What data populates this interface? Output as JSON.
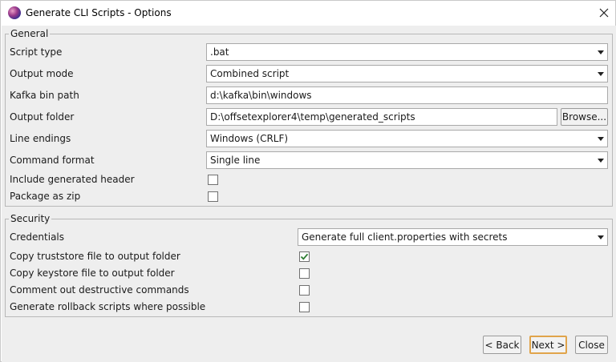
{
  "window": {
    "title": "Generate CLI Scripts - Options"
  },
  "icons": {
    "app": "app-logo-icon",
    "close": "close-icon",
    "dropdown": "chevron-down-icon",
    "check": "checkmark-icon"
  },
  "colors": {
    "dialog_bg": "#eeeeee",
    "default_button_border": "#e0a44b",
    "checkmark": "#2e7d32"
  },
  "general": {
    "title": "General",
    "script_type_label": "Script type",
    "script_type_value": ".bat",
    "output_mode_label": "Output mode",
    "output_mode_value": "Combined script",
    "kafka_bin_label": "Kafka bin path",
    "kafka_bin_value": "d:\\kafka\\bin\\windows",
    "output_folder_label": "Output folder",
    "output_folder_value": "D:\\offsetexplorer4\\temp\\generated_scripts",
    "browse_label": "Browse...",
    "line_endings_label": "Line endings",
    "line_endings_value": "Windows (CRLF)",
    "command_format_label": "Command format",
    "command_format_value": "Single line",
    "include_header_label": "Include generated header",
    "include_header_checked": false,
    "package_zip_label": "Package as zip",
    "package_zip_checked": false
  },
  "security": {
    "title": "Security",
    "credentials_label": "Credentials",
    "credentials_value": "Generate full client.properties with secrets",
    "copy_truststore_label": "Copy truststore file to output folder",
    "copy_truststore_checked": true,
    "copy_keystore_label": "Copy keystore file to output folder",
    "copy_keystore_checked": false,
    "comment_destructive_label": "Comment out destructive commands",
    "comment_destructive_checked": false,
    "rollback_label": "Generate rollback scripts where possible",
    "rollback_checked": false
  },
  "footer": {
    "back_label": "< Back",
    "next_label": "Next >",
    "close_label": "Close"
  }
}
